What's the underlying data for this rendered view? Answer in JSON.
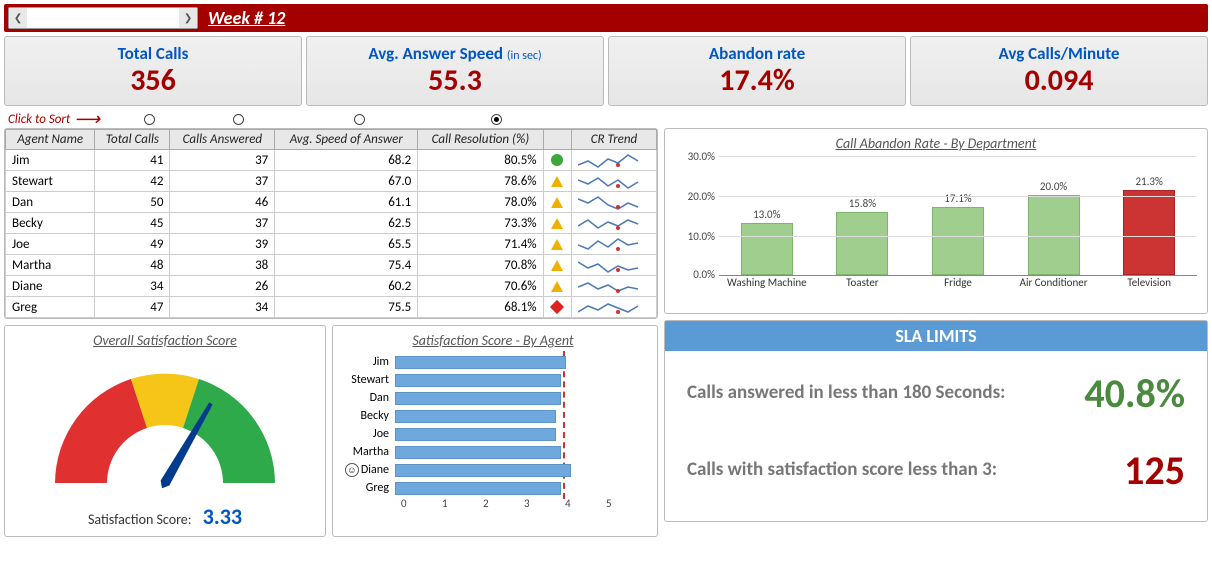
{
  "header": {
    "week_label": "Week # 12"
  },
  "kpi": [
    {
      "title": "Total Calls",
      "sub": "",
      "value": "356"
    },
    {
      "title": "Avg. Answer Speed",
      "sub": "(in sec)",
      "value": "55.3"
    },
    {
      "title": "Abandon rate",
      "sub": "",
      "value": "17.4%"
    },
    {
      "title": "Avg Calls/Minute",
      "sub": "",
      "value": "0.094"
    }
  ],
  "sort_hint": "Click to Sort",
  "table": {
    "headers": [
      "Agent Name",
      "Total Calls",
      "Calls Answered",
      "Avg. Speed of Answer",
      "Call Resolution (%)",
      "",
      "CR Trend"
    ],
    "rows": [
      {
        "name": "Jim",
        "calls": 41,
        "ans": 37,
        "speed": "68.2",
        "res": "80.5%",
        "ind": "green"
      },
      {
        "name": "Stewart",
        "calls": 42,
        "ans": 37,
        "speed": "67.0",
        "res": "78.6%",
        "ind": "yellow"
      },
      {
        "name": "Dan",
        "calls": 50,
        "ans": 46,
        "speed": "61.1",
        "res": "78.0%",
        "ind": "yellow"
      },
      {
        "name": "Becky",
        "calls": 45,
        "ans": 37,
        "speed": "62.5",
        "res": "73.3%",
        "ind": "yellow"
      },
      {
        "name": "Joe",
        "calls": 49,
        "ans": 39,
        "speed": "65.5",
        "res": "71.4%",
        "ind": "yellow"
      },
      {
        "name": "Martha",
        "calls": 48,
        "ans": 38,
        "speed": "75.4",
        "res": "70.8%",
        "ind": "yellow"
      },
      {
        "name": "Diane",
        "calls": 34,
        "ans": 26,
        "speed": "60.2",
        "res": "70.6%",
        "ind": "yellow"
      },
      {
        "name": "Greg",
        "calls": 47,
        "ans": 34,
        "speed": "75.5",
        "res": "68.1%",
        "ind": "red"
      }
    ]
  },
  "gauge": {
    "title": "Overall Satisfaction Score",
    "label": "Satisfaction Score:",
    "value": "3.33"
  },
  "agent_sat": {
    "title": "Satisfaction Score - By Agent",
    "max": 5,
    "target": 3.3,
    "highlight": "Diane",
    "rows": [
      {
        "name": "Jim",
        "val": 3.4
      },
      {
        "name": "Stewart",
        "val": 3.3
      },
      {
        "name": "Dan",
        "val": 3.3
      },
      {
        "name": "Becky",
        "val": 3.2
      },
      {
        "name": "Joe",
        "val": 3.2
      },
      {
        "name": "Martha",
        "val": 3.3
      },
      {
        "name": "Diane",
        "val": 3.5
      },
      {
        "name": "Greg",
        "val": 3.3
      }
    ],
    "axis": [
      "0",
      "1",
      "2",
      "3",
      "4",
      "5"
    ]
  },
  "abandon": {
    "title": "Call Abandon Rate - By Department"
  },
  "sla": {
    "header": "SLA LIMITS",
    "row1_text": "Calls answered in less than 180 Seconds:",
    "row1_val": "40.8%",
    "row2_text": "Calls with satisfaction score less than 3:",
    "row2_val": "125"
  },
  "chart_data": [
    {
      "type": "bar",
      "title": "Call Abandon Rate - By Department",
      "categories": [
        "Washing Machine",
        "Toaster",
        "Fridge",
        "Air Conditioner",
        "Television"
      ],
      "values": [
        13.0,
        15.8,
        17.1,
        20.0,
        21.3
      ],
      "value_labels": [
        "13.0%",
        "15.8%",
        "17.1%",
        "20.0%",
        "21.3%"
      ],
      "ylabel": "",
      "xlabel": "",
      "ylim": [
        0,
        30
      ],
      "yticks": [
        "0.0%",
        "10.0%",
        "20.0%",
        "30.0%"
      ],
      "highlight_index": 4
    },
    {
      "type": "bar",
      "orientation": "horizontal",
      "title": "Satisfaction Score - By Agent",
      "categories": [
        "Jim",
        "Stewart",
        "Dan",
        "Becky",
        "Joe",
        "Martha",
        "Diane",
        "Greg"
      ],
      "values": [
        3.4,
        3.3,
        3.3,
        3.2,
        3.2,
        3.3,
        3.5,
        3.3
      ],
      "xlim": [
        0,
        5
      ],
      "reference_line": 3.3
    },
    {
      "type": "gauge",
      "title": "Overall Satisfaction Score",
      "value": 3.33,
      "min": 0,
      "max": 5,
      "zones": [
        {
          "to": 2.5,
          "color": "red"
        },
        {
          "to": 3.5,
          "color": "yellow"
        },
        {
          "to": 5,
          "color": "green"
        }
      ]
    }
  ]
}
